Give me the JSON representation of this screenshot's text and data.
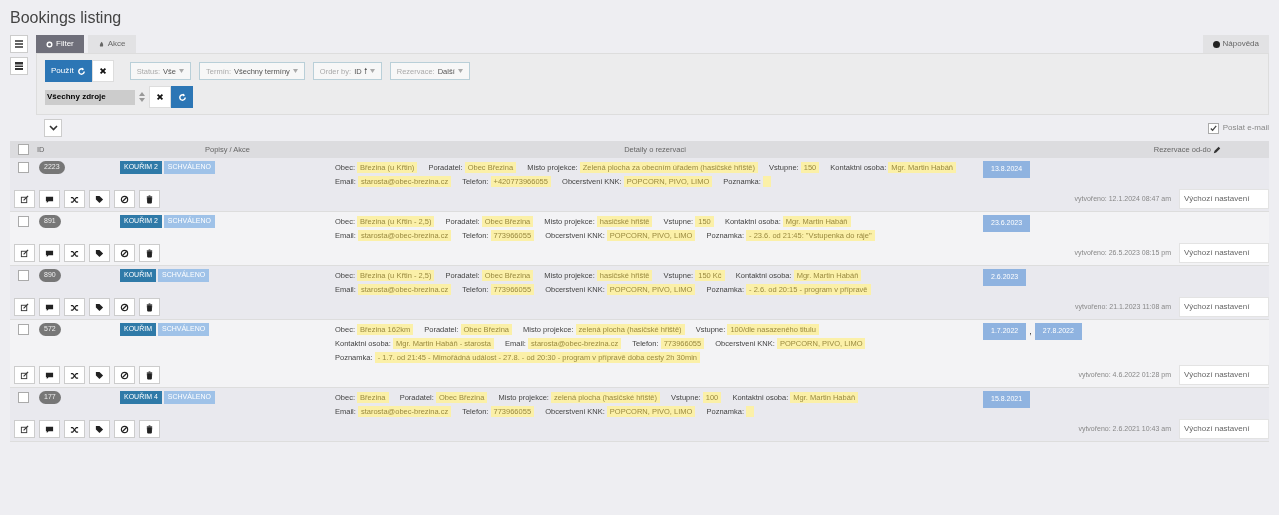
{
  "page_title": "Bookings listing",
  "side_buttons": [
    {
      "kind": "list"
    },
    {
      "kind": "grid"
    }
  ],
  "tabs": [
    {
      "label": "Filter",
      "selected": true
    },
    {
      "label": "Akce",
      "selected": false
    }
  ],
  "help_tab": {
    "label": "Nápověda"
  },
  "filter": {
    "apply_label": "Použít",
    "selects": [
      {
        "label": "Status:",
        "value": "Vše"
      },
      {
        "label": "Termín:",
        "value": "Všechny termíny"
      },
      {
        "label": "Order by:",
        "value": "ID 🠕"
      },
      {
        "label": "Rezervace:",
        "value": "Další"
      }
    ],
    "source": {
      "value": "Všechny zdroje"
    }
  },
  "send_email": {
    "label": "Poslat e-mail",
    "checked": true
  },
  "table": {
    "columns": [
      "ID",
      "Popisy / Akce",
      "Detaily o rezervaci",
      "Rezervace od-do"
    ],
    "all_checked": false,
    "date_separator": ",",
    "rows": [
      {
        "id": "2223",
        "checked": false,
        "badges": [
          {
            "kind": "source",
            "text": "KOUŘIM 2"
          },
          {
            "kind": "status",
            "text": "SCHVÁLENO"
          }
        ],
        "details": [
          {
            "label": "Obec:",
            "value": "Březina (u Křtin)"
          },
          {
            "label": "Poradatel:",
            "value": "Obec Březina"
          },
          {
            "label": "Misto projekce:",
            "value": "Zelená plocha za obecním úřadem (hasičské hřiště)"
          },
          {
            "label": "Vstupne:",
            "value": "150"
          },
          {
            "label": "Kontaktni osoba:",
            "value": "Mgr. Martin Habáň"
          },
          {
            "label": "Email:",
            "value": "starosta@obec-brezina.cz"
          },
          {
            "label": "Telefon:",
            "value": "+420773966055"
          },
          {
            "label": "Obcerstveni KNK:",
            "value": "POPCORN, PIVO, LIMO"
          },
          {
            "label": "Poznamka:"
          }
        ],
        "dates": [
          "13.8.2024"
        ],
        "created": "vytvořeno: 12.1.2024 08:47 am",
        "preset": "Výchozí nastavení"
      },
      {
        "id": "891",
        "checked": false,
        "badges": [
          {
            "kind": "source",
            "text": "KOUŘIM 2"
          },
          {
            "kind": "status",
            "text": "SCHVÁLENO"
          }
        ],
        "details": [
          {
            "label": "Obec:",
            "value": "Březina (u Křtin - 2,5)"
          },
          {
            "label": "Poradatel:",
            "value": "Obec Březina"
          },
          {
            "label": "Misto projekce:",
            "value": "hasičské hřiště"
          },
          {
            "label": "Vstupne:",
            "value": "150"
          },
          {
            "label": "Kontaktni osoba:",
            "value": "Mgr. Martin Habáň"
          },
          {
            "label": "Email:",
            "value": "starosta@obec-brezina.cz"
          },
          {
            "label": "Telefon:",
            "value": "773966055"
          },
          {
            "label": "Obcerstveni KNK:",
            "value": "POPCORN, PIVO, LIMO"
          },
          {
            "label": "Poznamka:",
            "value": "- 23.6. od 21:45: \"Vstupenka do ráje\""
          }
        ],
        "dates": [
          "23.6.2023"
        ],
        "created": "vytvořeno: 26.5.2023 08:15 pm",
        "preset": "Výchozí nastavení"
      },
      {
        "id": "890",
        "checked": false,
        "badges": [
          {
            "kind": "source",
            "text": "KOUŘIM"
          },
          {
            "kind": "status",
            "text": "SCHVÁLENO"
          }
        ],
        "details": [
          {
            "label": "Obec:",
            "value": "Březina (u Křtin - 2,5)"
          },
          {
            "label": "Poradatel:",
            "value": "Obec Březina"
          },
          {
            "label": "Misto projekce:",
            "value": "hasičské hřiště"
          },
          {
            "label": "Vstupne:",
            "value": "150 Kč"
          },
          {
            "label": "Kontaktni osoba:",
            "value": "Mgr. Martin Habáň"
          },
          {
            "label": "Email:",
            "value": "starosta@obec-brezina.cz"
          },
          {
            "label": "Telefon:",
            "value": "773966055"
          },
          {
            "label": "Obcerstveni KNK:",
            "value": "POPCORN, PIVO, LIMO"
          },
          {
            "label": "Poznamka:",
            "value": "- 2.6. od 20:15 - program v přípravě"
          }
        ],
        "dates": [
          "2.6.2023"
        ],
        "created": "vytvořeno: 21.1.2023 11:08 am",
        "preset": "Výchozí nastavení"
      },
      {
        "id": "572",
        "checked": false,
        "badges": [
          {
            "kind": "source",
            "text": "KOUŘIM"
          },
          {
            "kind": "status",
            "text": "SCHVÁLENO"
          }
        ],
        "details": [
          {
            "label": "Obec:",
            "value": "Březina 162km"
          },
          {
            "label": "Poradatel:",
            "value": "Obec Březina"
          },
          {
            "label": "Misto projekce:",
            "value": "zelená plocha (hasičské hřiště)"
          },
          {
            "label": "Vstupne:",
            "value": "100/dle nasazeného titulu"
          },
          {
            "label": "Kontaktni osoba:",
            "value": "Mgr. Martin Habáň - starosta"
          },
          {
            "label": "Email:",
            "value": "starosta@obec-brezina.cz"
          },
          {
            "label": "Telefon:",
            "value": "773966055"
          },
          {
            "label": "Obcerstveni KNK:",
            "value": "POPCORN, PIVO, LIMO"
          },
          {
            "label": "Poznamka:",
            "value": "- 1.7. od 21:45 - Mimořádná událost - 27.8. - od 20:30 - program v přípravě doba cesty 2h 30min"
          }
        ],
        "dates": [
          "1.7.2022",
          "27.8.2022"
        ],
        "created": "vytvořeno: 4.6.2022 01:28 pm",
        "preset": "Výchozí nastavení"
      },
      {
        "id": "177",
        "checked": false,
        "badges": [
          {
            "kind": "source",
            "text": "KOUŘIM 4"
          },
          {
            "kind": "status",
            "text": "SCHVÁLENO"
          }
        ],
        "details": [
          {
            "label": "Obec:",
            "value": "Březina"
          },
          {
            "label": "Poradatel:",
            "value": "Obec Březina"
          },
          {
            "label": "Misto projekce:",
            "value": "zelená plocha (hasičské hřiště)"
          },
          {
            "label": "Vstupne:",
            "value": "100"
          },
          {
            "label": "Kontaktni osoba:",
            "value": "Mgr. Martin Habáň"
          },
          {
            "label": "Email:",
            "value": "starosta@obec-brezina.cz"
          },
          {
            "label": "Telefon:",
            "value": "773966055"
          },
          {
            "label": "Obcerstveni KNK:",
            "value": "POPCORN, PIVO, LIMO"
          },
          {
            "label": "Poznamka:"
          }
        ],
        "dates": [
          "15.8.2021"
        ],
        "created": "vytvořeno: 2.6.2021 10:43 am",
        "preset": "Výchozí nastavení"
      }
    ]
  }
}
